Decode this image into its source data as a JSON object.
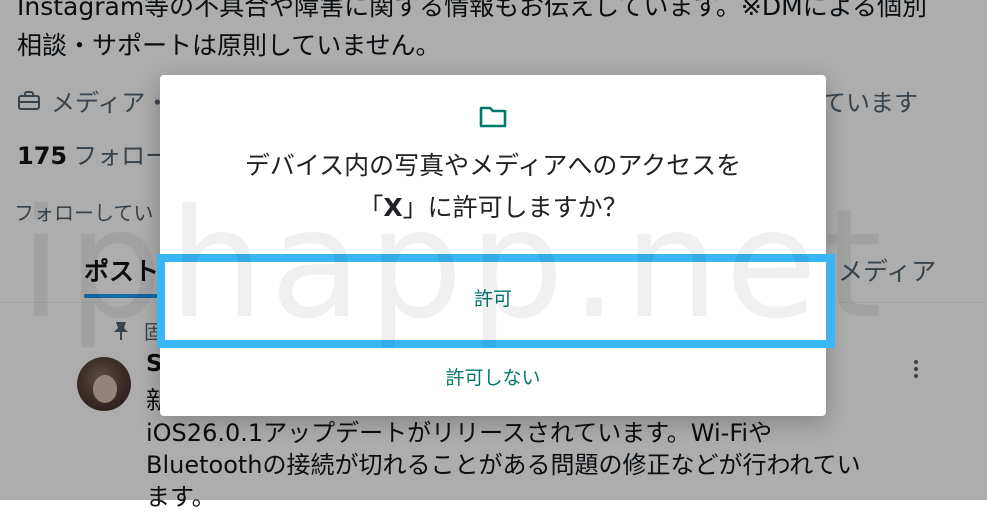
{
  "background": {
    "bio_line_1": "Instagram等の不具合や障害に関する情報もお伝えしています。※DMによる個別",
    "bio_line_2": "相談・サポートは原則していません。",
    "category": "メディア・",
    "category_right": "ています",
    "category_icon": "briefcase-icon",
    "follow_count": "175",
    "follow_label": "フォロー",
    "followed_by": "フォローしてい",
    "tabs": {
      "posts": "ポスト",
      "media": "メディア"
    },
    "pinned_icon": "pin-icon",
    "pinned_label": "固",
    "post": {
      "author_initial": "S",
      "first_char": "新",
      "line_1": "iOS26.0.1アップデートがリリースされています。Wi-Fiや",
      "line_2": "Bluetoothの接続が切れることがある問題の修正などが行われてい",
      "line_3": "ます。"
    },
    "watermark": "iphapp.net"
  },
  "dialog": {
    "icon": "folder-icon",
    "title_line_1": "デバイス内の写真やメディアへのアクセスを",
    "title_open_quote": "「",
    "app_name": "X",
    "title_line_2_rest": "」に許可しますか？",
    "allow_label": "許可",
    "deny_label": "許可しない"
  },
  "colors": {
    "accent_teal": "#00796b",
    "highlight_border": "#38b6f6",
    "tab_underline": "#1d9bf0",
    "scrim": "rgba(0,0,0,0.32)"
  }
}
